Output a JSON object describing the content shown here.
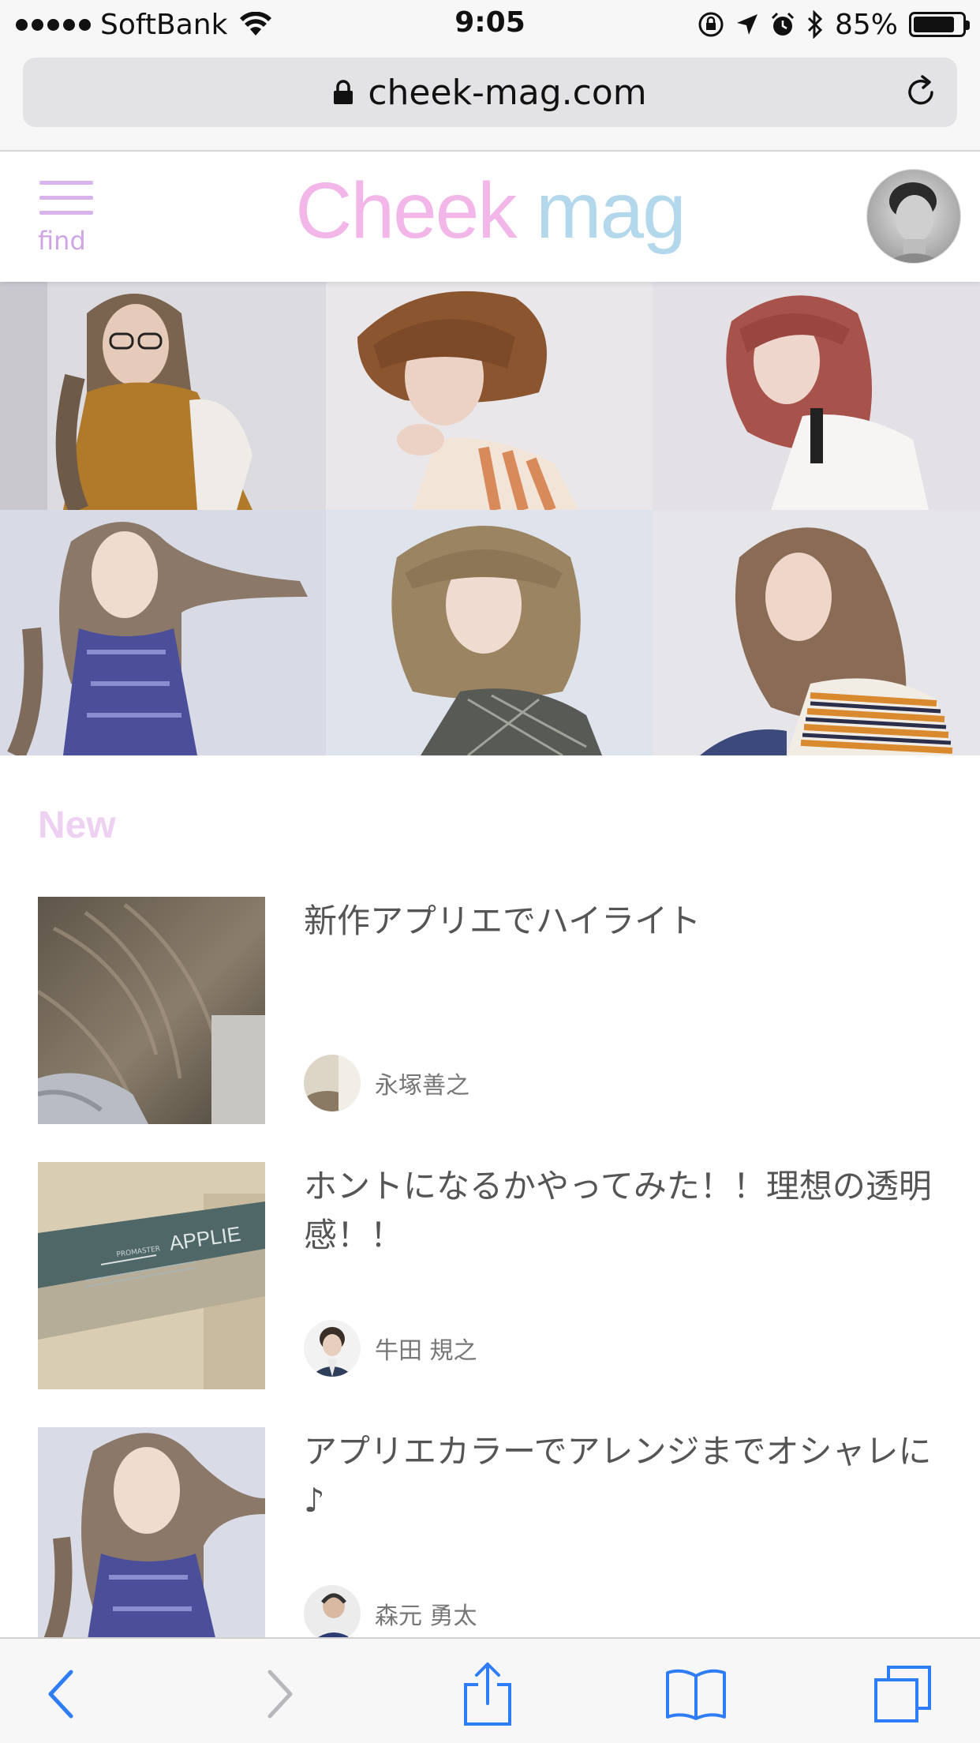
{
  "status_bar": {
    "carrier": "SoftBank",
    "time": "9:05",
    "battery_percent": "85%",
    "battery_level": 0.85,
    "icons": [
      "signal-dots",
      "wifi-icon",
      "rotation-lock-icon",
      "location-icon",
      "alarm-icon",
      "bluetooth-icon",
      "battery-icon"
    ]
  },
  "browser": {
    "url": "cheek-mag.com",
    "icons": [
      "lock-icon",
      "reload-icon"
    ]
  },
  "header": {
    "menu_label": "find",
    "logo_part1": "Cheek",
    "logo_part2": "mag",
    "colors": {
      "logo_pink": "#f2b6e8",
      "logo_blue": "#b3d8ec",
      "menu_purple": "#d9b4ec"
    }
  },
  "gallery": {
    "photos": [
      {
        "name": "hair-photo-long-wavy-glasses"
      },
      {
        "name": "hair-photo-short-brown"
      },
      {
        "name": "hair-photo-red-medium"
      },
      {
        "name": "hair-photo-long-windblown"
      },
      {
        "name": "hair-photo-bob-bangs"
      },
      {
        "name": "hair-photo-long-wavy-striped"
      }
    ]
  },
  "new_section": {
    "heading": "New",
    "heading_color": "#eed0f2",
    "articles": [
      {
        "title": "新作アプリエでハイライト",
        "author": "永塚善之"
      },
      {
        "title": "ホントになるかやってみた！！理想の透明感！！",
        "author": "牛田 規之"
      },
      {
        "title": "アプリエカラーでアレンジまでオシャレに♪",
        "author": "森元 勇太"
      }
    ],
    "thumb2_text": "APPLIE",
    "thumb2_subtext": "PROMASTER"
  },
  "toolbar": {
    "icons": [
      "back-icon",
      "forward-icon",
      "share-icon",
      "bookmarks-icon",
      "tabs-icon"
    ],
    "accent": "#2f7df6"
  }
}
